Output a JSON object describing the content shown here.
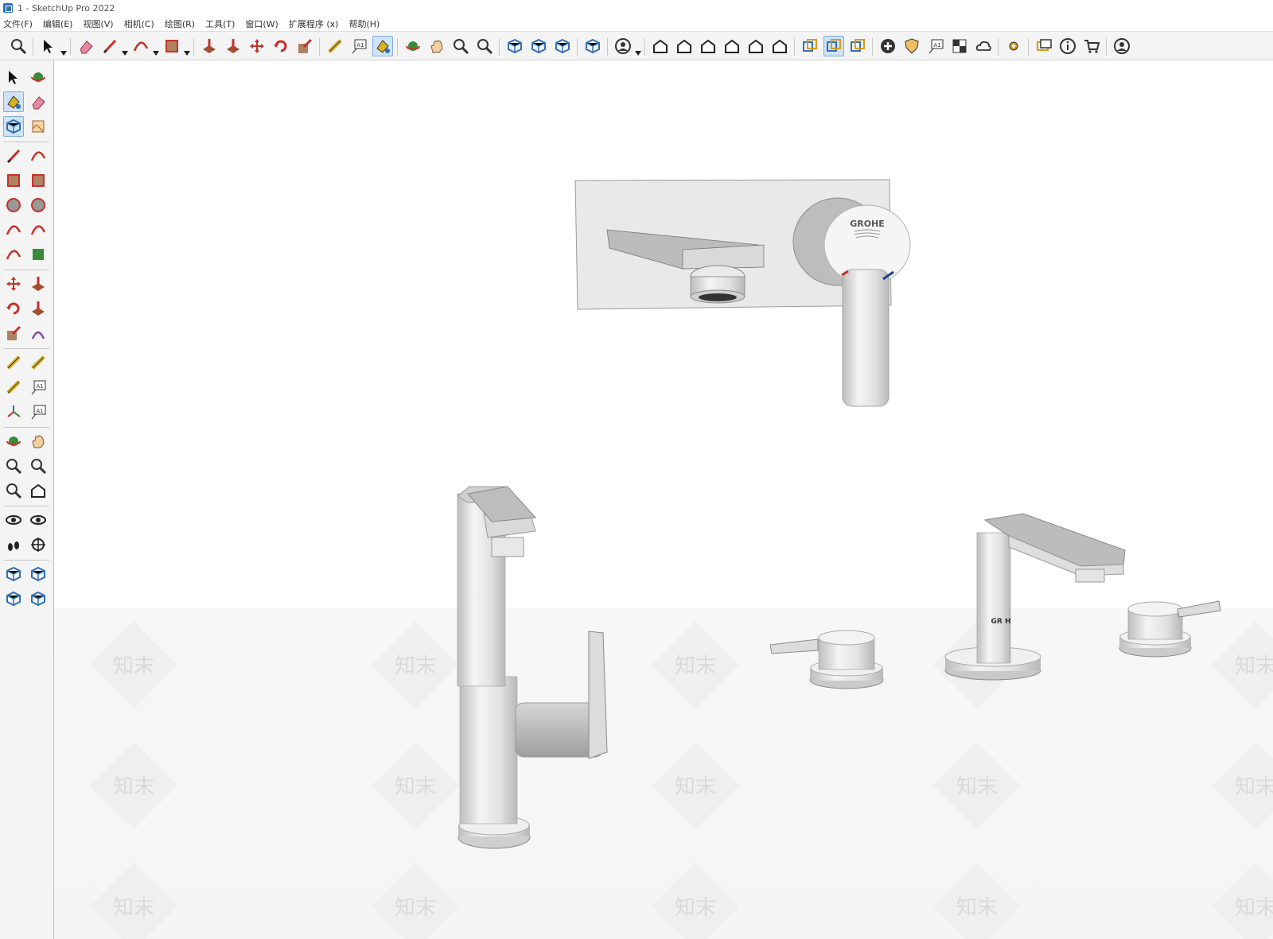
{
  "window": {
    "title": "1 - SketchUp Pro 2022"
  },
  "menu": [
    "文件(F)",
    "编辑(E)",
    "视图(V)",
    "相机(C)",
    "绘图(R)",
    "工具(T)",
    "窗口(W)",
    "扩展程序 (x)",
    "帮助(H)"
  ],
  "top_toolbar": [
    {
      "icon": "search-icon"
    },
    {
      "icon": "select-arrow-icon",
      "dropdown": true
    },
    {
      "icon": "eraser-icon"
    },
    {
      "icon": "pencil-line-icon",
      "dropdown": true
    },
    {
      "icon": "arc-icon",
      "dropdown": true
    },
    {
      "icon": "rectangle-icon",
      "dropdown": true
    },
    {
      "icon": "push-pull-icon"
    },
    {
      "icon": "follow-me-icon"
    },
    {
      "icon": "move-icon"
    },
    {
      "icon": "rotate-icon"
    },
    {
      "icon": "scale-icon"
    },
    {
      "icon": "tape-measure-icon"
    },
    {
      "icon": "text-label-icon"
    },
    {
      "icon": "paint-bucket-icon",
      "active": true
    },
    {
      "icon": "orbit-icon"
    },
    {
      "icon": "pan-icon"
    },
    {
      "icon": "zoom-icon"
    },
    {
      "icon": "zoom-extents-icon"
    },
    {
      "icon": "3d-warehouse-icon"
    },
    {
      "icon": "extension-warehouse-icon"
    },
    {
      "icon": "layout-icon"
    },
    {
      "icon": "extension-manager-icon"
    },
    {
      "icon": "account-icon",
      "dropdown": true
    },
    {
      "icon": "iso-view-icon"
    },
    {
      "icon": "top-view-icon"
    },
    {
      "icon": "front-view-icon"
    },
    {
      "icon": "right-view-icon"
    },
    {
      "icon": "back-view-icon"
    },
    {
      "icon": "left-view-icon"
    },
    {
      "icon": "solid-inspector-icon"
    },
    {
      "icon": "outer-shell-icon",
      "active": true
    },
    {
      "icon": "trimble-connect-icon"
    },
    {
      "icon": "add-location-icon"
    },
    {
      "icon": "shield-icon"
    },
    {
      "icon": "photo-texture-icon"
    },
    {
      "icon": "checker-icon"
    },
    {
      "icon": "cloud-upload-icon"
    },
    {
      "icon": "settings-icon"
    },
    {
      "icon": "chat-icon"
    },
    {
      "icon": "info-icon"
    },
    {
      "icon": "cart-icon"
    },
    {
      "icon": "user-profile-icon"
    }
  ],
  "left_toolbar": [
    [
      "select-icon",
      "orbit-icon"
    ],
    [
      "paint-bucket-icon",
      "eraser-icon"
    ],
    [
      "make-component-icon",
      "tag-icon"
    ],
    [
      "line-icon",
      "freehand-icon"
    ],
    [
      "rectangle-icon",
      "rotated-rectangle-icon"
    ],
    [
      "circle-icon",
      "polygon-icon"
    ],
    [
      "arc-icon",
      "two-point-arc-icon"
    ],
    [
      "three-point-arc-icon",
      "pie-icon"
    ],
    [
      "move-icon",
      "push-pull-icon"
    ],
    [
      "rotate-icon",
      "follow-me-icon"
    ],
    [
      "scale-icon",
      "offset-icon"
    ],
    [
      "tape-measure-icon",
      "dimension-icon"
    ],
    [
      "protractor-icon",
      "text-icon"
    ],
    [
      "axes-icon",
      "3d-text-icon"
    ],
    [
      "orbit-view-icon",
      "pan-icon"
    ],
    [
      "zoom-icon",
      "zoom-window-icon"
    ],
    [
      "zoom-extents-icon",
      "previous-view-icon"
    ],
    [
      "position-camera-icon",
      "look-around-icon"
    ],
    [
      "walk-icon",
      "section-plane-icon"
    ],
    [
      "3d-warehouse-icon",
      "extension-warehouse-icon"
    ],
    [
      "layout-icon",
      "extension-manager-icon"
    ]
  ],
  "scene": {
    "brand_label": "GROHE",
    "brand_label_small": "GR   H",
    "watermark": "知末"
  },
  "colors": {
    "active_bg": "#cfe3f6",
    "accent_red": "#d03020",
    "accent_blue": "#1c3f95"
  }
}
